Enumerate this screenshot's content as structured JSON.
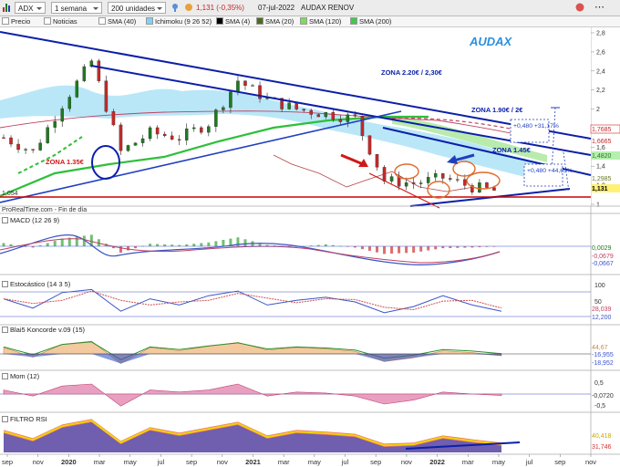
{
  "toolbar": {
    "ticker": "ADX",
    "period": "1 semana",
    "units": "200 unidades",
    "price_change": "1,131 (-0,35%)",
    "date": "07-jul-2022",
    "name": "AUDAX RENOV"
  },
  "legend": [
    "Precio",
    "Noticias",
    "SMA (40)",
    "Ichimoku (9 26 52)",
    "SMA (4)",
    "SMA (20)",
    "SMA (120)",
    "SMA (200)"
  ],
  "colors": {
    "up": "#1f7a1f",
    "down": "#c62828",
    "accent": "#1f3fbf",
    "zone": "#0b1fa8",
    "support": "#cc0000"
  },
  "chart_data": [
    {
      "type": "line",
      "title": "AUDAX",
      "subtitle": "ProRealTime.com - Fin de día",
      "x": [
        "sep 2019",
        "nov 2019",
        "ene 2020",
        "mar 2020",
        "may 2020",
        "jul 2020",
        "sep 2020",
        "nov 2020",
        "ene 2021",
        "mar 2021",
        "may 2021",
        "jul 2021",
        "sep 2021",
        "nov 2021",
        "ene 2022",
        "mar 2022",
        "may 2022",
        "jul 2022"
      ],
      "series": [
        {
          "values": [
            1.7,
            1.55,
            2.05,
            2.5,
            1.55,
            1.75,
            1.7,
            1.85,
            2.3,
            2.1,
            2.0,
            1.95,
            1.9,
            1.25,
            1.22,
            1.28,
            1.18,
            1.13
          ]
        }
      ],
      "ylim": [
        1.0,
        2.8
      ],
      "y_ticks": [
        "2,8",
        "2,6",
        "2,4",
        "2,2",
        "2",
        "1,8",
        "1,6",
        "1,4",
        "1,2",
        "1"
      ],
      "price_labels": [
        "1,7685",
        "1,6665",
        "1,4820",
        "1,2985",
        "1,131",
        "1,054"
      ],
      "annotations": [
        "ZONA 2.20€ / 2,30€",
        "ZONA 1.90€ / 2€",
        "ZONA 1.45€",
        "ZONA 1.35€",
        "+0,480 +31,17%",
        "+0,480 +44,65%"
      ]
    },
    {
      "type": "bar",
      "title": "MACD (12 26 9)",
      "series": [
        {
          "values": [
            0.05,
            -0.02,
            0.12,
            0.18,
            -0.1,
            0.04,
            0.02,
            0.06,
            0.14,
            0.02,
            -0.01,
            0.03,
            -0.02,
            -0.12,
            -0.1,
            -0.03,
            -0.02,
            0.0
          ]
        }
      ],
      "value_labels": [
        "0,0029",
        "-0,0679",
        "-0,0667"
      ]
    },
    {
      "type": "line",
      "title": "Estocástico (14 3 5)",
      "series": [
        {
          "values": [
            60,
            30,
            80,
            90,
            20,
            60,
            40,
            70,
            85,
            40,
            55,
            65,
            50,
            15,
            35,
            70,
            40,
            20
          ]
        }
      ],
      "ylim": [
        0,
        100
      ],
      "y_ticks": [
        "100",
        "50",
        "0"
      ],
      "value_labels": [
        "28,039",
        "12,200"
      ]
    },
    {
      "type": "area",
      "title": "Blai5 Koncorde v.09 (15)",
      "series": [
        {
          "values": [
            10,
            -5,
            15,
            20,
            -15,
            10,
            5,
            12,
            18,
            6,
            10,
            8,
            4,
            -12,
            -6,
            5,
            2,
            -3
          ]
        }
      ],
      "value_labels": [
        "44,67",
        "-16,955",
        "-18,952"
      ]
    },
    {
      "type": "bar",
      "title": "Mom (12)",
      "series": [
        {
          "values": [
            0.2,
            -0.1,
            0.4,
            0.5,
            -0.6,
            0.2,
            0.1,
            0.2,
            0.5,
            -0.1,
            0.1,
            0.05,
            -0.1,
            -0.5,
            -0.3,
            0.1,
            0.0,
            -0.07
          ]
        }
      ],
      "y_ticks": [
        "0,5",
        "-0,5"
      ],
      "value_labels": [
        "-0,0720"
      ]
    },
    {
      "type": "area",
      "title": "FILTRO RSI",
      "series": [
        {
          "values": [
            55,
            40,
            65,
            75,
            35,
            60,
            50,
            60,
            70,
            45,
            55,
            52,
            48,
            30,
            32,
            45,
            38,
            32
          ]
        }
      ],
      "value_labels": [
        "40,418",
        "31,746"
      ]
    }
  ],
  "x_axis_labels": [
    "sep",
    "nov",
    "2020",
    "mar",
    "may",
    "jul",
    "sep",
    "nov",
    "2021",
    "mar",
    "may",
    "jul",
    "sep",
    "nov",
    "2022",
    "mar",
    "may",
    "jul",
    "sep",
    "nov"
  ]
}
